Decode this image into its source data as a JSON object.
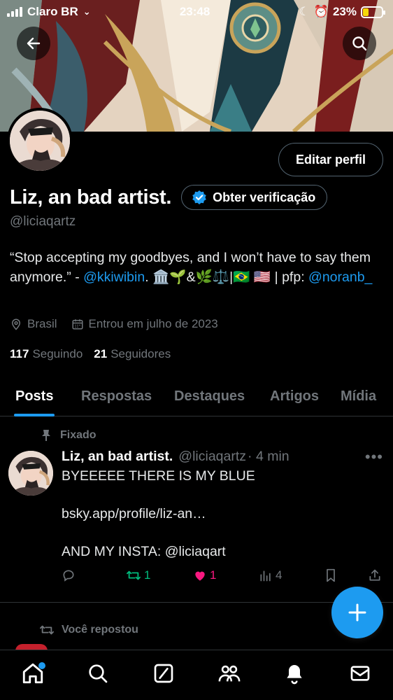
{
  "status_bar": {
    "carrier": "Claro BR",
    "time": "23:48",
    "battery": "23%",
    "battery_level": 0.23
  },
  "header": {
    "back_icon": "arrow-left-icon",
    "search_icon": "search-icon"
  },
  "profile": {
    "edit_label": "Editar perfil",
    "display_name": "Liz, an bad artist.",
    "verify_label": "Obter verificação",
    "handle": "@liciaqartz",
    "bio_part1": "“Stop accepting my goodbyes, and I won’t have to say them anymore.” - ",
    "bio_mention1": "@kkiwibin",
    "bio_part2": ". 🏛️🌱&🌿⚖️|🇧🇷 🇺🇸 | pfp: ",
    "bio_mention2": "@noranb_",
    "location": "Brasil",
    "joined": "Entrou em julho de 2023",
    "following_count": "117",
    "following_label": "Seguindo",
    "followers_count": "21",
    "followers_label": "Seguidores"
  },
  "tabs": [
    "Posts",
    "Respostas",
    "Destaques",
    "Artigos",
    "Mídia"
  ],
  "pinned_post": {
    "pinned_label": "Fixado",
    "author_name": "Liz, an bad artist.",
    "author_handle": "@liciaqartz",
    "time": "· 4 min",
    "line1": "BYEEEEE THERE IS MY BLUE",
    "link": "bsky.app/profile/liz-an…",
    "line3": "AND MY INSTA: @liciaqart",
    "reposts": "1",
    "likes": "1",
    "views": "4",
    "colors": {
      "repost": "#00ba7c",
      "like": "#f91880",
      "link": "#1d9bf0"
    }
  },
  "next_post": {
    "repost_label": "Você repostou"
  },
  "fab": {
    "icon": "plus-icon"
  },
  "bottom_nav": [
    "home-icon",
    "search-icon",
    "grok-icon",
    "communities-icon",
    "notifications-icon",
    "messages-icon"
  ]
}
